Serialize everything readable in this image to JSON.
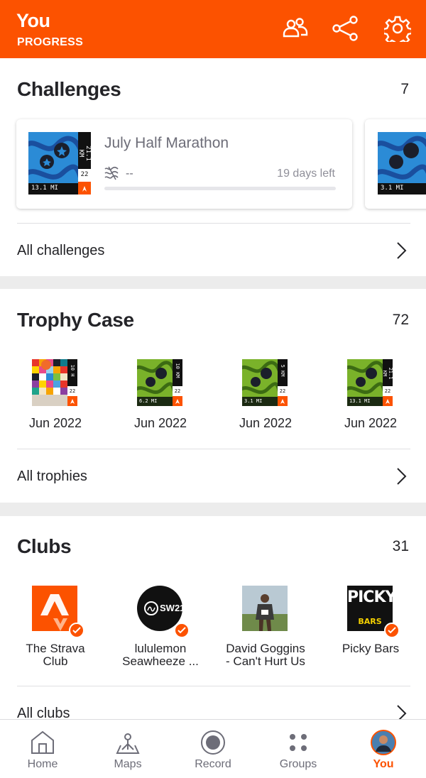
{
  "header": {
    "title": "You",
    "subtitle": "PROGRESS",
    "colors": {
      "brand": "#fc5200"
    },
    "icons": [
      "athletes-icon",
      "share-icon",
      "gear-icon"
    ]
  },
  "challenges": {
    "title": "Challenges",
    "count": "7",
    "card": {
      "name": "July Half Marathon",
      "stat": "--",
      "days_left": "19 days left",
      "progress": 0,
      "badge": {
        "km": "21.1 KM",
        "year": "22",
        "mi": "13.1 MI"
      }
    },
    "next_card_badge": {
      "mi": "3.1 MI"
    },
    "all_label": "All challenges"
  },
  "trophies": {
    "title": "Trophy Case",
    "count": "72",
    "items": [
      {
        "date": "Jun 2022",
        "side": "10 H",
        "year": "22",
        "mi": ""
      },
      {
        "date": "Jun 2022",
        "side": "10 KM",
        "year": "22",
        "mi": "6.2 MI"
      },
      {
        "date": "Jun 2022",
        "side": "5 KM",
        "year": "22",
        "mi": "3.1 MI"
      },
      {
        "date": "Jun 2022",
        "side": "21.1 KM",
        "year": "22",
        "mi": "13.1 MI"
      }
    ],
    "all_label": "All trophies"
  },
  "clubs": {
    "title": "Clubs",
    "count": "31",
    "items": [
      {
        "name": "The Strava Club",
        "line1": "The Strava",
        "line2": "Club"
      },
      {
        "name": "lululemon Seawheeze ...",
        "line1": "lululemon",
        "line2": "Seawheeze ...",
        "logo_text": "SW21"
      },
      {
        "name": "David Goggins - Can't Hurt Us",
        "line1": "David Goggins",
        "line2": "- Can't Hurt Us"
      },
      {
        "name": "Picky Bars",
        "line1": "Picky Bars",
        "line2": "",
        "logo_text_1": "PICKY",
        "logo_text_2": "BARS"
      }
    ],
    "all_label": "All clubs"
  },
  "tabbar": {
    "tabs": [
      {
        "label": "Home",
        "icon": "home-icon"
      },
      {
        "label": "Maps",
        "icon": "maps-icon"
      },
      {
        "label": "Record",
        "icon": "record-icon"
      },
      {
        "label": "Groups",
        "icon": "groups-icon"
      },
      {
        "label": "You",
        "icon": "avatar",
        "active": true
      }
    ]
  }
}
